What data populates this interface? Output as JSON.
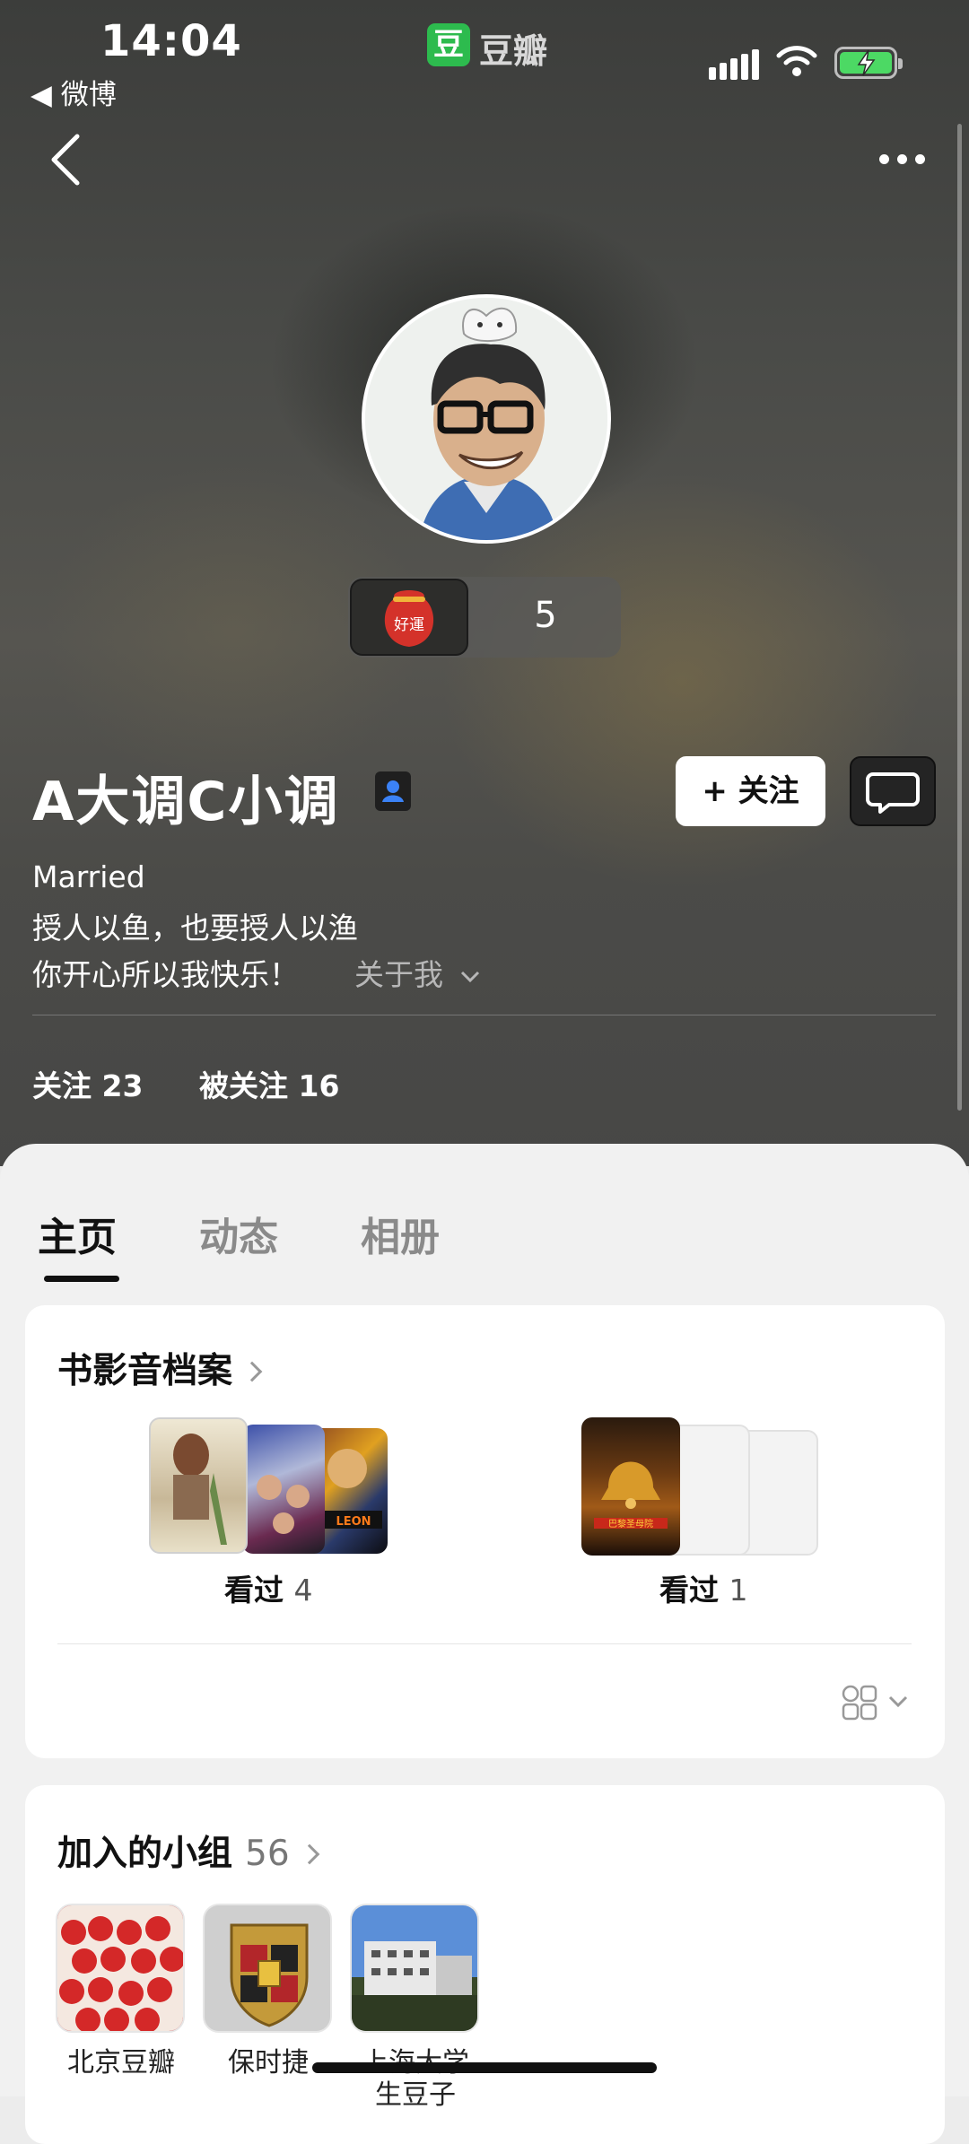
{
  "status_bar": {
    "time": "14:04",
    "back_app": "◀ 微博",
    "app_badge": "豆",
    "app_name": "豆瓣",
    "icons": [
      "signal-icon",
      "wifi-icon",
      "battery-charging-icon"
    ]
  },
  "nav": {
    "back_icon": "chevron-left-icon",
    "more_icon": "more-dots-icon"
  },
  "profile": {
    "luck_label": "好運",
    "luck_count": "5",
    "name": "A大调C小调",
    "follow_label": "+ 关注",
    "bio": [
      "Married",
      "授人以鱼，也要授人以渔",
      "你开心所以我快乐！"
    ],
    "about_label": "关于我",
    "following": "关注 23",
    "followers": "被关注 16"
  },
  "tabs": [
    "主页",
    "动态",
    "相册"
  ],
  "active_tab": 0,
  "archive": {
    "title": "书影音档案",
    "items": [
      {
        "label": "看过",
        "count": "4"
      },
      {
        "label": "看过",
        "count": "1"
      }
    ]
  },
  "groups": {
    "title": "加入的小组",
    "count": "56",
    "items": [
      {
        "name": "北京豆瓣"
      },
      {
        "name": "保时捷"
      },
      {
        "name": "上海大学\n生豆子"
      }
    ]
  },
  "colors": {
    "accent_green": "#2dbb4e",
    "sheet_bg": "#f1f1f1",
    "card_bg": "#ffffff"
  }
}
